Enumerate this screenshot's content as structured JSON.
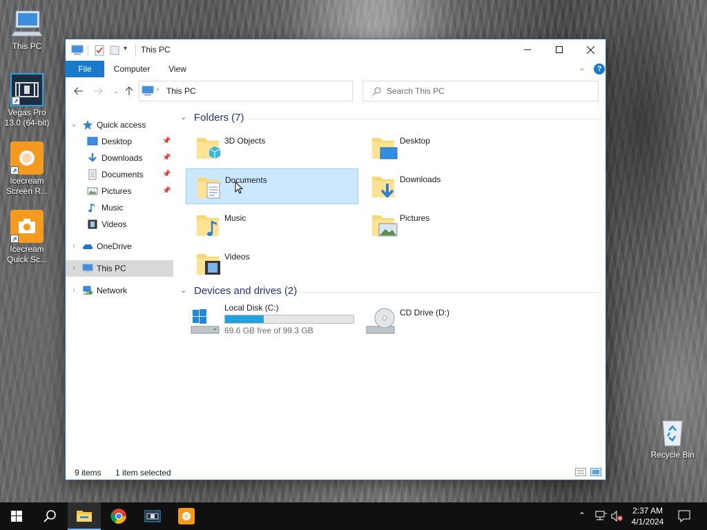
{
  "desktop": {
    "icons": [
      {
        "label": "This PC"
      },
      {
        "label": "Vegas Pro 13.0 (64-bit)"
      },
      {
        "label": "Icecream Screen R..."
      },
      {
        "label": "Icecream Quick Sc..."
      },
      {
        "label": "Recycle Bin"
      }
    ]
  },
  "window": {
    "title": "This PC",
    "ribbon_tabs": [
      "File",
      "Computer",
      "View"
    ],
    "address": {
      "path": "This PC"
    },
    "search": {
      "placeholder": "Search This PC"
    },
    "nav": [
      {
        "label": "Quick access"
      },
      {
        "label": "Desktop",
        "pinned": true
      },
      {
        "label": "Downloads",
        "pinned": true
      },
      {
        "label": "Documents",
        "pinned": true
      },
      {
        "label": "Pictures",
        "pinned": true
      },
      {
        "label": "Music"
      },
      {
        "label": "Videos"
      },
      {
        "label": "OneDrive"
      },
      {
        "label": "This PC",
        "selected": true
      },
      {
        "label": "Network"
      }
    ],
    "folders_header": "Folders (7)",
    "folders": [
      {
        "label": "3D Objects"
      },
      {
        "label": "Desktop"
      },
      {
        "label": "Documents",
        "selected": true
      },
      {
        "label": "Downloads"
      },
      {
        "label": "Music"
      },
      {
        "label": "Pictures"
      },
      {
        "label": "Videos"
      }
    ],
    "drives_header": "Devices and drives (2)",
    "drives": [
      {
        "label": "Local Disk (C:)",
        "free_text": "69.6 GB free of 99.3 GB",
        "used_fraction": 0.3
      },
      {
        "label": "CD Drive (D:)"
      }
    ],
    "status": {
      "items": "9 items",
      "selected": "1 item selected"
    }
  },
  "taskbar": {
    "time": "2:37 AM",
    "date": "4/1/2024"
  },
  "colors": {
    "accent": "#1979ca",
    "selection": "#cce8ff",
    "drive_bar": "#26a0da",
    "group_header": "#1e3287"
  }
}
